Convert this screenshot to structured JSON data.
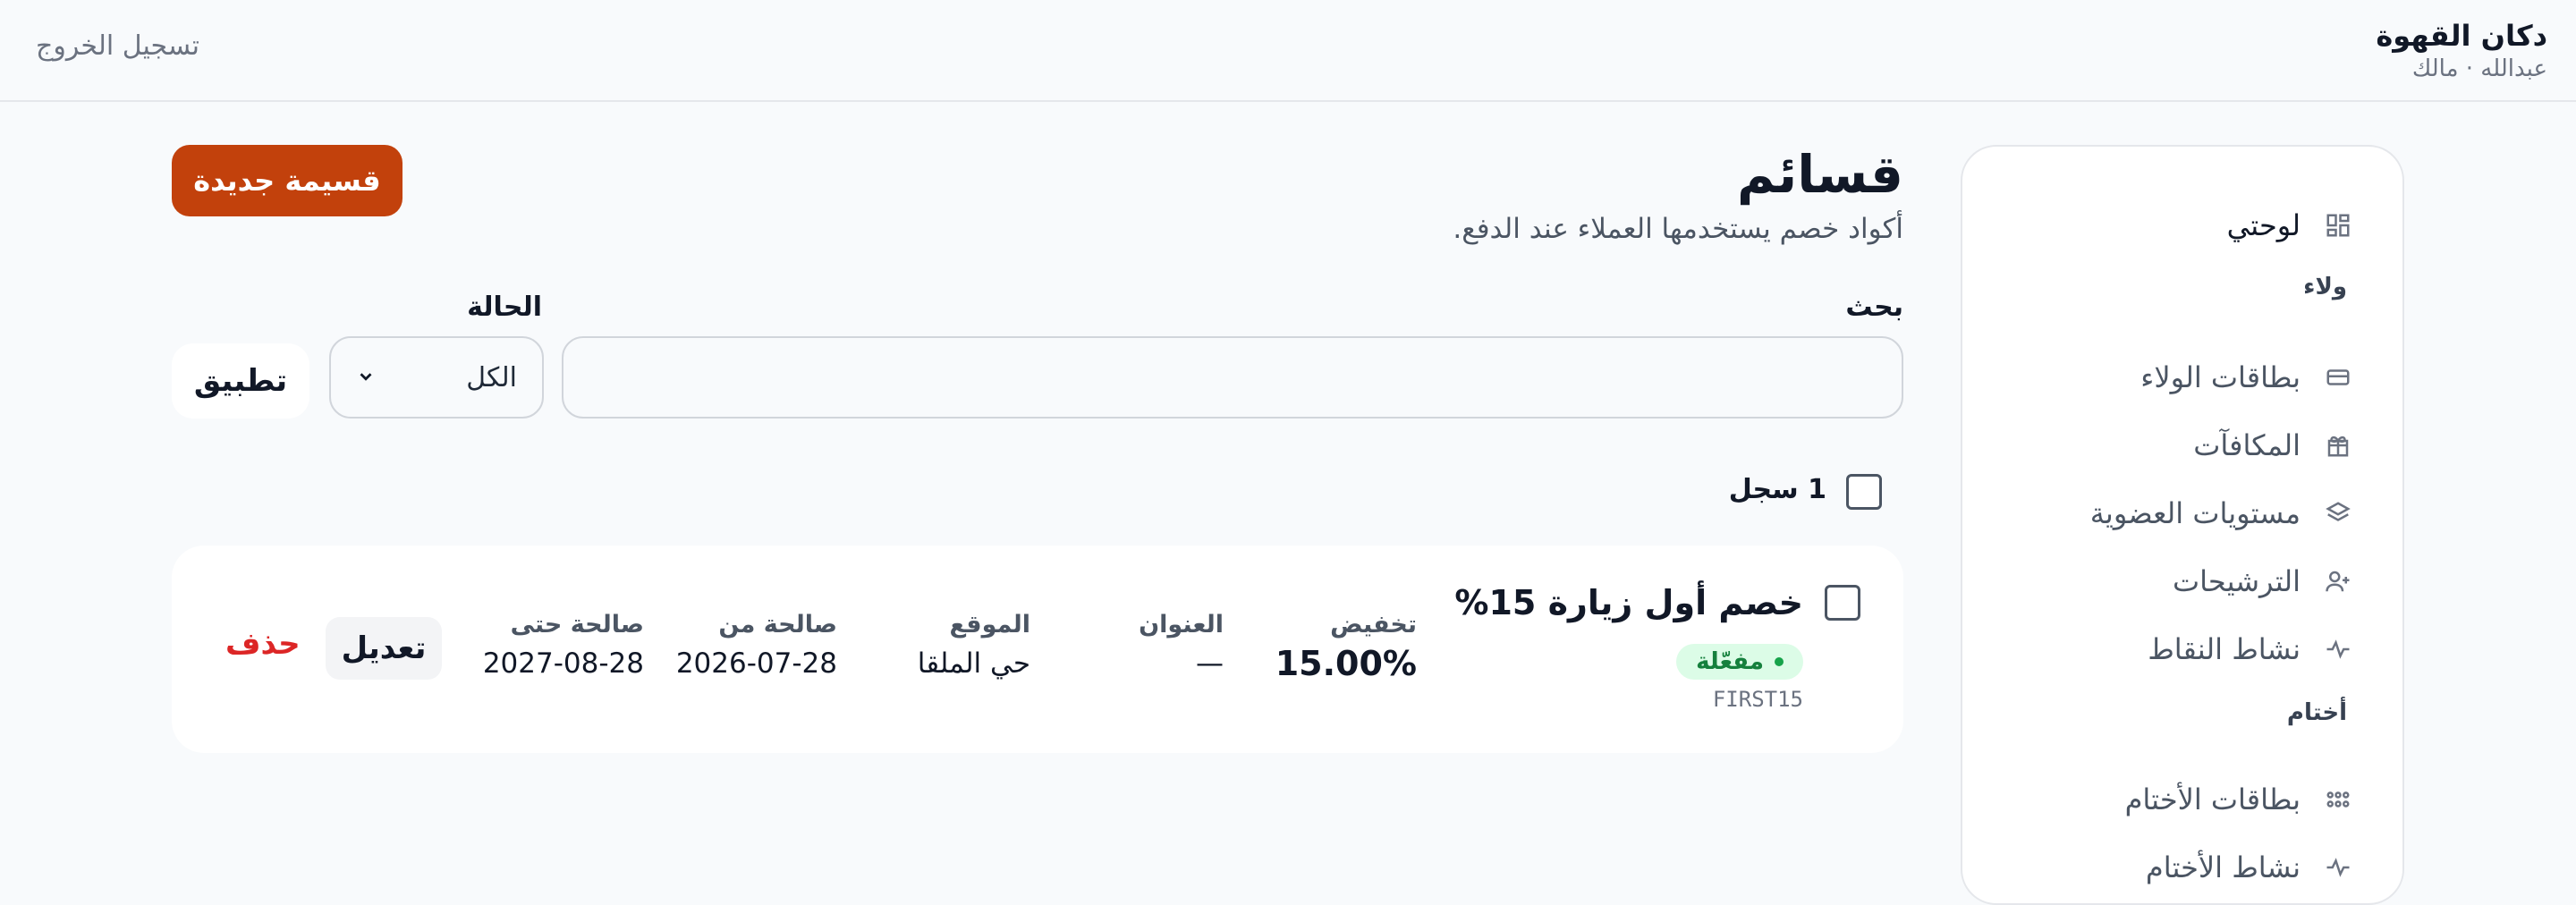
{
  "header": {
    "brand": "دكان القهوة",
    "user": "عبدالله · مالك",
    "logout": "تسجيل الخروج"
  },
  "sidebar": {
    "dashboard": "لوحتي",
    "loyalty_heading": "ولاء",
    "loyalty_items": [
      "بطاقات الولاء",
      "المكافآت",
      "مستويات العضوية",
      "الترشيحات",
      "نشاط النقاط"
    ],
    "stamps_heading": "أختام",
    "stamps_items": [
      "بطاقات الأختام",
      "نشاط الأختام"
    ]
  },
  "page": {
    "title": "قسائم",
    "subtitle": "أكواد خصم يستخدمها العملاء عند الدفع.",
    "new_button": "قسيمة جديدة"
  },
  "filters": {
    "search_label": "بحث",
    "search_value": "",
    "status_label": "الحالة",
    "status_value": "الكل",
    "apply": "تطبيق"
  },
  "list": {
    "count_label": "1 سجل",
    "coupons": [
      {
        "title": "خصم أول زيارة 15%",
        "status": "مفعّلة",
        "code": "FIRST15",
        "discount_label": "تخفيض",
        "discount": "15.00%",
        "address_label": "العنوان",
        "address": "—",
        "location_label": "الموقع",
        "location": "حي الملقا",
        "valid_from_label": "صالحة من",
        "valid_from": "2026-07-28",
        "valid_until_label": "صالحة حتى",
        "valid_until": "2027-08-28",
        "edit": "تعديل",
        "delete": "حذف"
      }
    ]
  },
  "colors": {
    "accent": "#c2410c",
    "success": "#15803d",
    "danger": "#dc2626"
  }
}
